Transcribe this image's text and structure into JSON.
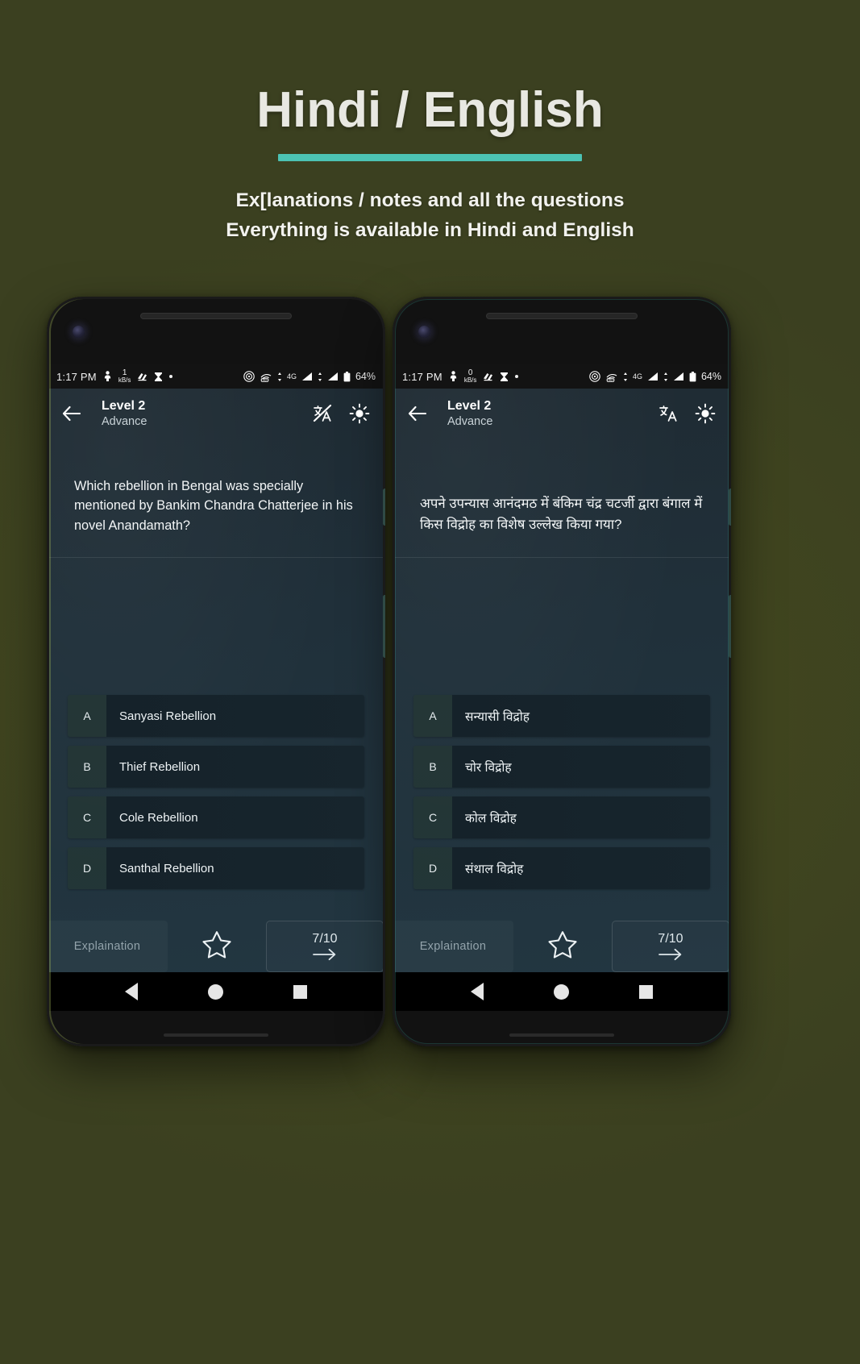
{
  "promo": {
    "title": "Hindi / English",
    "subtitle_line1": "Ex[lanations / notes and all the questions",
    "subtitle_line2": "Everything is available in Hindi and English",
    "accent_color": "#4cc3b4",
    "background_color": "#3d4023"
  },
  "phones": [
    {
      "id": "english-phone",
      "status_bar": {
        "time": "1:17 PM",
        "data_rate_value": "1",
        "data_rate_unit": "kB/s",
        "network_type": "4G",
        "battery_percent": "64%",
        "icons": [
          "person-icon",
          "data-transfer-icon",
          "hands-icon",
          "hourglass-icon",
          "dot-icon",
          "nfc-icon",
          "vowifi-icon",
          "signal-icon",
          "signal-icon-2",
          "battery-icon"
        ]
      },
      "appbar": {
        "back_icon": "arrow-left-icon",
        "title": "Level 2",
        "subtitle": "Advance",
        "translate_icon": "translate-off-icon",
        "brightness_icon": "brightness-icon"
      },
      "question": "Which rebellion in Bengal was specially mentioned by Bankim Chandra Chatterjee in his novel Anandamath?",
      "options": [
        {
          "letter": "A",
          "text": "Sanyasi Rebellion"
        },
        {
          "letter": "B",
          "text": "Thief Rebellion"
        },
        {
          "letter": "C",
          "text": "Cole Rebellion"
        },
        {
          "letter": "D",
          "text": "Santhal Rebellion"
        }
      ],
      "bottom_bar": {
        "explanation_label": "Explaination",
        "star_icon": "star-outline-icon",
        "progress": "7/10",
        "next_icon": "arrow-right-icon"
      },
      "nav_bar": {
        "back": "nav-back-triangle",
        "home": "nav-home-circle",
        "recents": "nav-recents-square"
      }
    },
    {
      "id": "hindi-phone",
      "status_bar": {
        "time": "1:17 PM",
        "data_rate_value": "0",
        "data_rate_unit": "kB/s",
        "network_type": "4G",
        "battery_percent": "64%",
        "icons": [
          "person-icon",
          "data-transfer-icon",
          "hands-icon",
          "hourglass-icon",
          "dot-icon",
          "nfc-icon",
          "vowifi-icon",
          "signal-icon",
          "signal-icon-2",
          "battery-icon"
        ]
      },
      "appbar": {
        "back_icon": "arrow-left-icon",
        "title": "Level 2",
        "subtitle": "Advance",
        "translate_icon": "translate-icon",
        "brightness_icon": "brightness-icon"
      },
      "question": "अपने उपन्यास आनंदमठ में बंकिम चंद्र चटर्जी द्वारा बंगाल में किस विद्रोह का विशेष उल्लेख किया गया?",
      "options": [
        {
          "letter": "A",
          "text": "सन्यासी विद्रोह"
        },
        {
          "letter": "B",
          "text": "चोर विद्रोह"
        },
        {
          "letter": "C",
          "text": "कोल विद्रोह"
        },
        {
          "letter": "D",
          "text": "संथाल विद्रोह"
        }
      ],
      "bottom_bar": {
        "explanation_label": "Explaination",
        "star_icon": "star-outline-icon",
        "progress": "7/10",
        "next_icon": "arrow-right-icon"
      },
      "nav_bar": {
        "back": "nav-back-triangle",
        "home": "nav-home-circle",
        "recents": "nav-recents-square"
      }
    }
  ]
}
